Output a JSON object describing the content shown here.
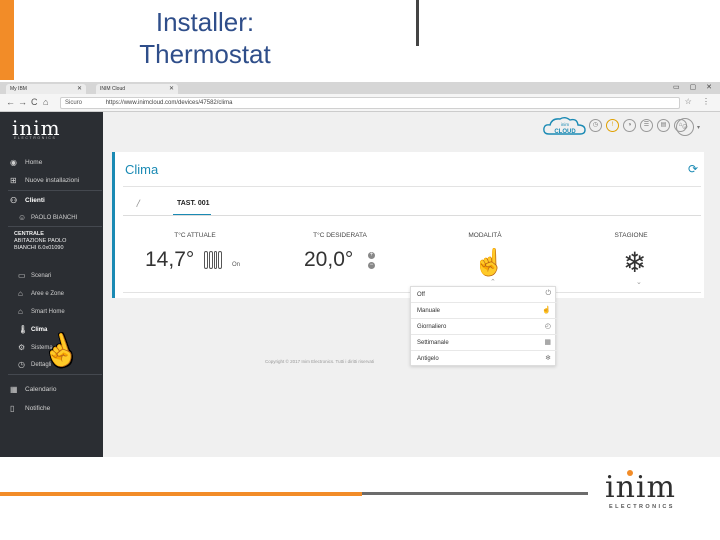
{
  "slide": {
    "title_line1": "Installer:",
    "title_line2": "Thermostat",
    "accent_color": "#f28c28",
    "title_color": "#2f4e8a"
  },
  "browser": {
    "tabs": [
      {
        "label": "My IBM",
        "close": "✕"
      },
      {
        "label": "INIM Cloud",
        "close": "✕"
      }
    ],
    "url": "https://www.inimcloud.com/devices/47582/clima",
    "url_prefix": "Sicuro",
    "nav_icons": [
      "←",
      "→",
      "C",
      "⌂"
    ]
  },
  "sidebar": {
    "logo": "inim",
    "logo_sub": "ELECTRONICS",
    "items": [
      {
        "label": "Home",
        "icon": "dashboard-icon",
        "glyph": "◉"
      },
      {
        "label": "Nuove installazioni",
        "icon": "install-icon",
        "glyph": "⊞"
      },
      {
        "label": "Clienti",
        "icon": "clients-icon",
        "glyph": "⚇"
      },
      {
        "label": "PAOLO BIANCHI",
        "icon": "user-icon",
        "glyph": "☺"
      },
      {
        "label": "Scenari",
        "icon": "scenarios-icon",
        "glyph": "▭"
      },
      {
        "label": "Aree e Zone",
        "icon": "areas-icon",
        "glyph": "⌂"
      },
      {
        "label": "Smart Home",
        "icon": "smart-home-icon",
        "glyph": "⌂"
      },
      {
        "label": "Clima",
        "icon": "thermometer-icon",
        "glyph": "🌡"
      },
      {
        "label": "Sistema",
        "icon": "system-icon",
        "glyph": "⚙"
      },
      {
        "label": "Dettagli",
        "icon": "details-icon",
        "glyph": "◷"
      },
      {
        "label": "Calendario",
        "icon": "calendar-icon",
        "glyph": "▦"
      },
      {
        "label": "Notifiche",
        "icon": "notifications-icon",
        "glyph": "▯"
      }
    ],
    "centrale_title": "CENTRALE",
    "centrale_lines": [
      "ABITAZIONE PAOLO",
      "BIANCHI 6.0x01090"
    ]
  },
  "header": {
    "cloud_brand_top": "inim",
    "cloud_brand": "CLOUD",
    "icons": [
      "◷",
      "!",
      "◑",
      "☰",
      "▤",
      "⌂"
    ],
    "user_glyph": "☺",
    "user_caret": "▾"
  },
  "clima": {
    "title": "Clima",
    "refresh_glyph": "⟳",
    "thermostat_tab": "TAST. 001",
    "columns": {
      "current_label": "T°C ATTUALE",
      "current_value": "14,7°",
      "current_state": "On",
      "desired_label": "T°C DESIDERATA",
      "desired_value": "20,0°",
      "mode_label": "MODALITÀ",
      "season_label": "STAGIONE"
    },
    "plus": "+",
    "minus": "−",
    "mode_glyph": "☝",
    "season_glyph": "❄",
    "caret_up": "⌃",
    "caret_down": "⌄",
    "mode_options": [
      {
        "label": "Off",
        "glyph": "⏻"
      },
      {
        "label": "Manuale",
        "glyph": "☝"
      },
      {
        "label": "Giornaliero",
        "glyph": "◴"
      },
      {
        "label": "Settimanale",
        "glyph": "▦"
      },
      {
        "label": "Antigelo",
        "glyph": "❄"
      }
    ]
  },
  "copyright": "Copyright © 2017 Inim Electronics. Tutti i diritti riservati",
  "footer": {
    "logo": "inim",
    "logo_sub": "ELECTRONICS"
  }
}
